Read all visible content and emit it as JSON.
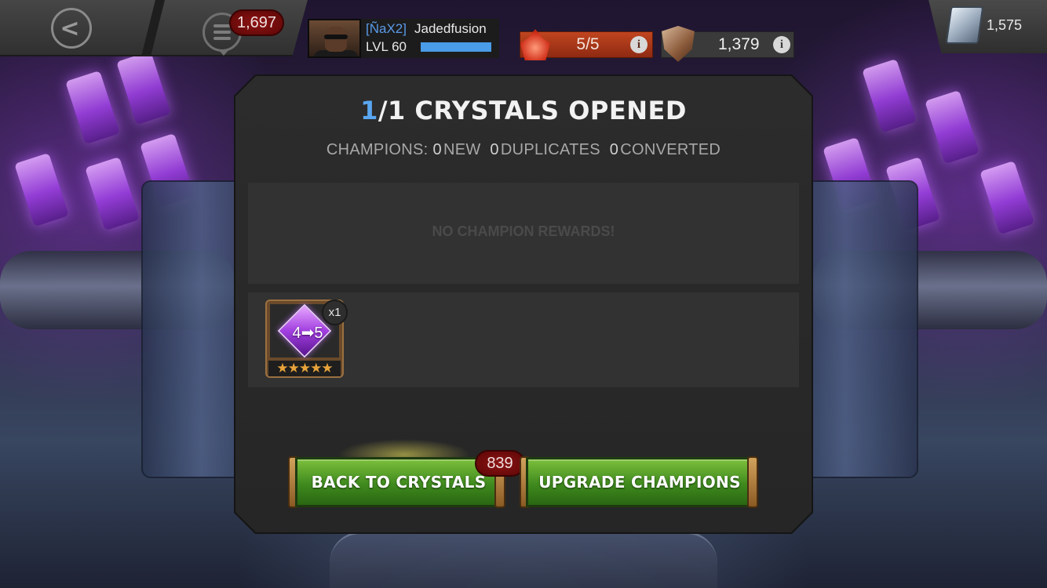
{
  "topbar": {
    "back_icon": "back-arrow-icon",
    "menu_icon": "menu-icon",
    "notification_count": "1,697",
    "player": {
      "alliance_tag": "[ÑaX2]",
      "name": "Jadedfusion",
      "level": "LVL 60",
      "xp_fraction": 1.0
    },
    "energy": {
      "value": "5/5",
      "icon": "energy-flame-icon",
      "info_icon": "info-icon"
    },
    "arena": {
      "value": "1,379",
      "icon": "arena-shield-icon",
      "info_icon": "info-icon"
    },
    "gold": {
      "value": "1,575",
      "icon": "gold-bar-icon"
    }
  },
  "results": {
    "title_opened": "1",
    "title_rest": "/1 CRYSTALS OPENED",
    "summary": {
      "prefix": "CHAMPIONS:",
      "new_count": "0",
      "new_label": "NEW",
      "duplicates_count": "0",
      "duplicates_label": "DUPLICATES",
      "converted_count": "0",
      "converted_label": "CONVERTED"
    },
    "no_rewards": "NO CHAMPION REWARDS!",
    "items": [
      {
        "label": "4➡5",
        "stars": "★★★★★",
        "quantity": "x1",
        "icon": "rank-up-gem-icon"
      }
    ]
  },
  "buttons": {
    "back_to_crystals": "BACK TO CRYSTALS",
    "crystals_count": "839",
    "upgrade_champions": "UPGRADE CHAMPIONS"
  },
  "colors": {
    "accent_blue": "#5aa6f0",
    "button_green": "#3f8a1e",
    "badge_red": "#8e1414",
    "energy_orange": "#c0451f",
    "gem_purple": "#a23fe0"
  }
}
